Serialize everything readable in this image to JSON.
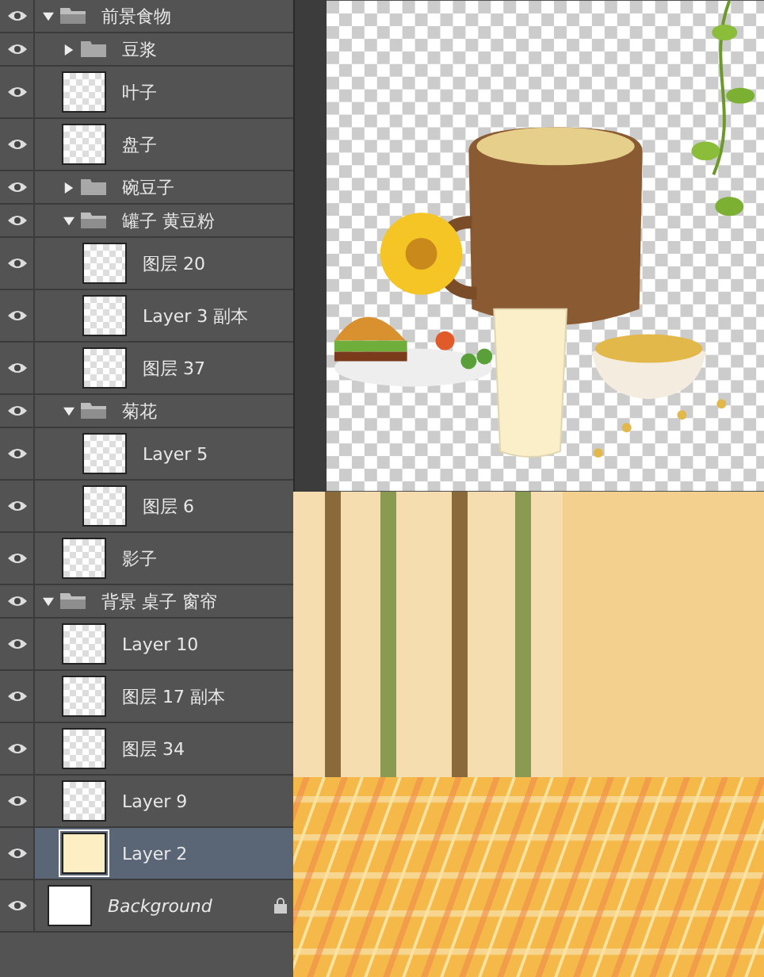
{
  "layers": [
    {
      "kind": "group",
      "name": "前景食物",
      "visible": true,
      "expanded": true,
      "selected": false,
      "children": [
        {
          "kind": "group",
          "name": "豆浆",
          "visible": true,
          "expanded": false,
          "selected": false
        },
        {
          "kind": "layer",
          "name": "叶子",
          "visible": true,
          "selected": false
        },
        {
          "kind": "layer",
          "name": "盘子",
          "visible": true,
          "selected": false
        },
        {
          "kind": "group",
          "name": "碗豆子",
          "visible": true,
          "expanded": false,
          "selected": false
        },
        {
          "kind": "group",
          "name": "罐子 黄豆粉",
          "visible": true,
          "expanded": true,
          "selected": false,
          "children": [
            {
              "kind": "layer",
              "name": "图层 20",
              "visible": true,
              "selected": false
            },
            {
              "kind": "layer",
              "name": "Layer 3 副本",
              "visible": true,
              "selected": false
            },
            {
              "kind": "layer",
              "name": "图层 37",
              "visible": true,
              "selected": false
            }
          ]
        },
        {
          "kind": "group",
          "name": "菊花",
          "visible": true,
          "expanded": true,
          "selected": false,
          "children": [
            {
              "kind": "layer",
              "name": "Layer 5",
              "visible": true,
              "selected": false
            },
            {
              "kind": "layer",
              "name": "图层 6",
              "visible": true,
              "selected": false
            }
          ]
        },
        {
          "kind": "layer",
          "name": "影子",
          "visible": true,
          "selected": false
        }
      ]
    },
    {
      "kind": "group",
      "name": "背景 桌子 窗帘",
      "visible": true,
      "expanded": true,
      "selected": false,
      "children": [
        {
          "kind": "layer",
          "name": "Layer 10",
          "visible": true,
          "selected": false
        },
        {
          "kind": "layer",
          "name": "图层 17 副本",
          "visible": true,
          "selected": false
        },
        {
          "kind": "layer",
          "name": "图层 34",
          "visible": true,
          "selected": false
        },
        {
          "kind": "layer",
          "name": "Layer 9",
          "visible": true,
          "selected": false
        },
        {
          "kind": "fill",
          "name": "Layer 2",
          "visible": true,
          "selected": true
        }
      ]
    },
    {
      "kind": "background",
      "name": "Background",
      "visible": true,
      "locked": true,
      "selected": false
    }
  ]
}
